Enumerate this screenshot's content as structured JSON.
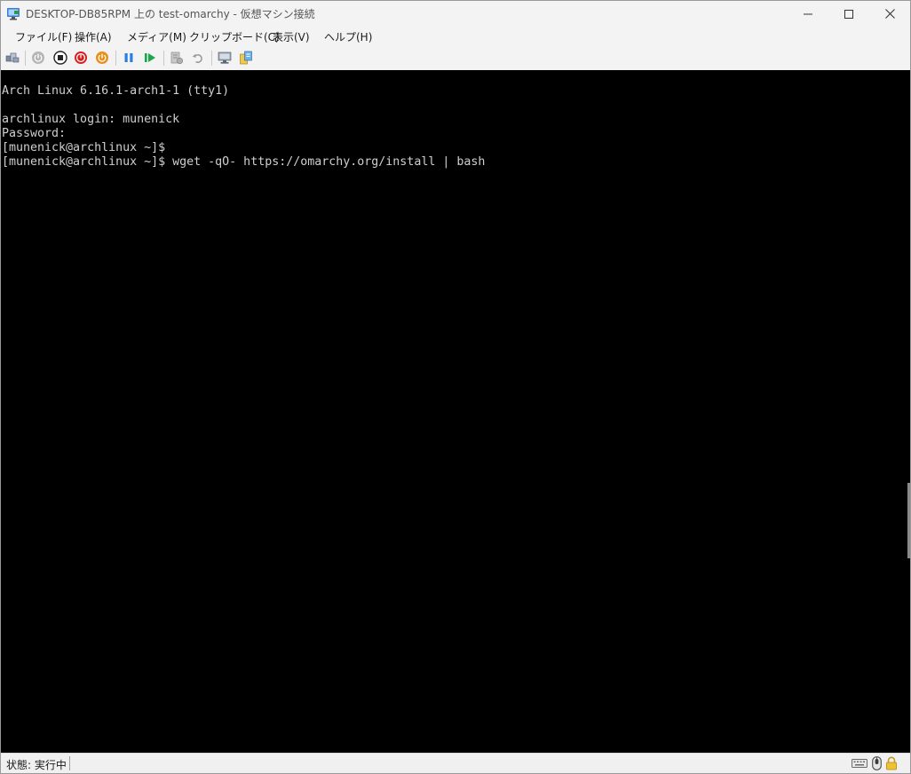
{
  "window": {
    "title": "DESKTOP-DB85RPM 上の test-omarchy  - 仮想マシン接続"
  },
  "menu": {
    "items": [
      {
        "label": "ファイル(F)"
      },
      {
        "label": "操作(A)"
      },
      {
        "label": "メディア(M)"
      },
      {
        "label": "クリップボード(C)"
      },
      {
        "label": "表示(V)"
      },
      {
        "label": "ヘルプ(H)"
      }
    ]
  },
  "toolbar": {
    "buttons": [
      {
        "icon": "ctrl-alt-del-icon"
      },
      {
        "icon": "start-icon",
        "color": "#a8a8a8"
      },
      {
        "icon": "turn-off-icon",
        "color": "#222222"
      },
      {
        "icon": "shut-down-icon",
        "color": "#d42020"
      },
      {
        "icon": "save-icon",
        "color": "#e8901c"
      },
      {
        "icon": "pause-icon",
        "color": "#2a7de1"
      },
      {
        "icon": "reset-icon",
        "color": "#18a84a"
      },
      {
        "icon": "checkpoint-icon"
      },
      {
        "icon": "revert-icon"
      },
      {
        "icon": "enhanced-session-icon"
      },
      {
        "icon": "share-icon"
      }
    ]
  },
  "console": {
    "lines": [
      "Arch Linux 6.16.1-arch1-1 (tty1)",
      "",
      "archlinux login: munenick",
      "Password:",
      "[munenick@archlinux ~]$",
      "[munenick@archlinux ~]$ wget -qO- https://omarchy.org/install | bash"
    ],
    "text_color": "#cfcfcf",
    "background": "#000000"
  },
  "status": {
    "text": "状態: 実行中",
    "icons": [
      "keyboard-icon",
      "mouse-icon",
      "lock-icon"
    ]
  }
}
